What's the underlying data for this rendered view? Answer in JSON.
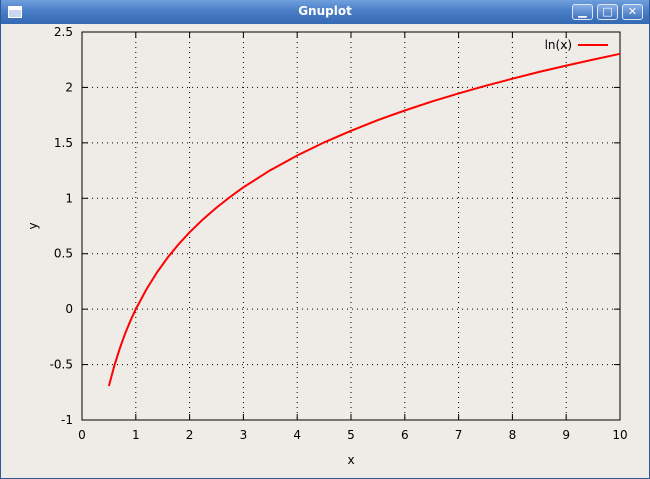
{
  "window": {
    "title": "Gnuplot",
    "minimize_symbol": "▁",
    "maximize_symbol": "□",
    "close_symbol": "✕",
    "icons": {
      "app": "window-icon",
      "minimize": "minimize-icon",
      "maximize": "maximize-icon",
      "close": "close-icon"
    },
    "colors": {
      "titlebar": "#4a7fc8",
      "background": "#efebe7"
    }
  },
  "chart_data": {
    "type": "line",
    "xlabel": "x",
    "ylabel": "y",
    "xlim": [
      0,
      10
    ],
    "ylim": [
      -1,
      2.5
    ],
    "xticks": [
      "0",
      "1",
      "2",
      "3",
      "4",
      "5",
      "6",
      "7",
      "8",
      "9",
      "10"
    ],
    "yticks": [
      "-1",
      "-0.5",
      "0",
      "0.5",
      "1",
      "1.5",
      "2",
      "2.5"
    ],
    "grid": true,
    "legend_position": "top-right",
    "series": [
      {
        "name": "ln(x)",
        "color": "#ff0000",
        "x": [
          0.5,
          0.6,
          0.7,
          0.8,
          0.9,
          1.0,
          1.2,
          1.4,
          1.6,
          1.8,
          2.0,
          2.25,
          2.5,
          2.75,
          3.0,
          3.5,
          4.0,
          4.5,
          5.0,
          5.5,
          6.0,
          6.5,
          7.0,
          7.5,
          8.0,
          8.5,
          9.0,
          9.5,
          10.0
        ],
        "y": [
          -0.693,
          -0.511,
          -0.357,
          -0.223,
          -0.105,
          0.0,
          0.182,
          0.336,
          0.47,
          0.588,
          0.693,
          0.811,
          0.916,
          1.012,
          1.099,
          1.253,
          1.386,
          1.504,
          1.609,
          1.705,
          1.792,
          1.872,
          1.946,
          2.015,
          2.079,
          2.14,
          2.197,
          2.251,
          2.303
        ]
      }
    ]
  }
}
